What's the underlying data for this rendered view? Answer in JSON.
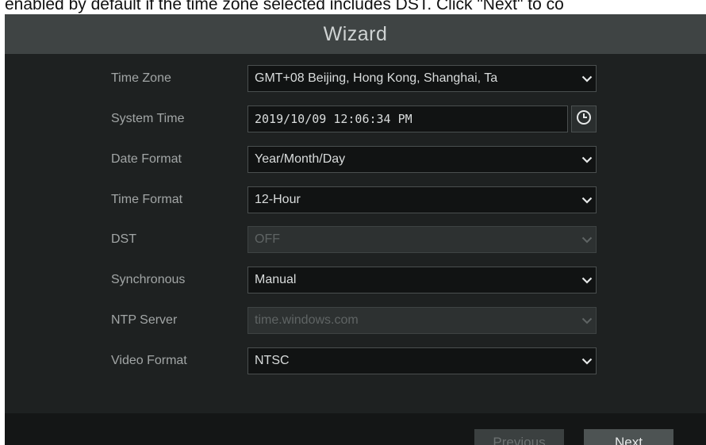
{
  "doc_text": "enabled by default if the time zone selected includes DST. Click \"Next\" to co",
  "wizard": {
    "title": "Wizard",
    "fields": [
      {
        "label": "Time Zone",
        "value": "GMT+08 Beijing, Hong Kong, Shanghai, Ta",
        "type": "select",
        "disabled": false
      },
      {
        "label": "System Time",
        "value": "2019/10/09 12:06:34 PM",
        "type": "datetime",
        "disabled": false
      },
      {
        "label": "Date Format",
        "value": "Year/Month/Day",
        "type": "select",
        "disabled": false
      },
      {
        "label": "Time Format",
        "value": "12-Hour",
        "type": "select",
        "disabled": false
      },
      {
        "label": "DST",
        "value": "OFF",
        "type": "select",
        "disabled": true
      },
      {
        "label": "Synchronous",
        "value": "Manual",
        "type": "select",
        "disabled": false
      },
      {
        "label": "NTP Server",
        "value": "time.windows.com",
        "type": "select",
        "disabled": true
      },
      {
        "label": "Video Format",
        "value": "NTSC",
        "type": "select",
        "disabled": false
      }
    ],
    "buttons": {
      "previous": "Previous",
      "next": "Next"
    }
  },
  "icons": {
    "dropdown": "chevron-down-icon",
    "clock": "clock-icon"
  },
  "colors": {
    "panel": "#1e2121",
    "title_bar": "#3f4444",
    "field": "#111313",
    "label": "#a2a6a6"
  }
}
